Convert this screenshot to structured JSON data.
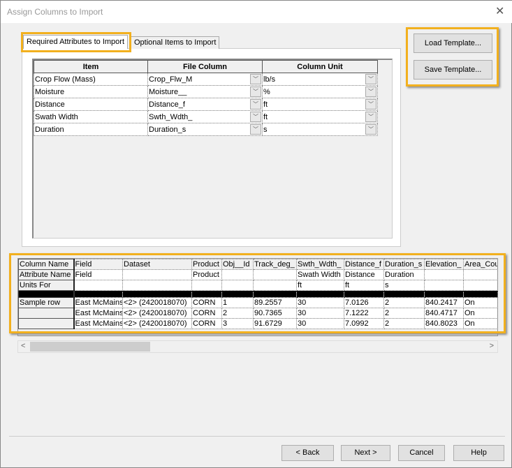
{
  "window": {
    "title": "Assign Columns to Import",
    "close": "✕"
  },
  "tabs": [
    {
      "label": "Required Attributes to Import"
    },
    {
      "label": "Optional Items to Import"
    }
  ],
  "required": {
    "headers": [
      "Item",
      "File Column",
      "Column Unit"
    ],
    "rows": [
      {
        "item": "Crop Flow (Mass)",
        "file_column": "Crop_Flw_M",
        "unit": "lb/s"
      },
      {
        "item": "Moisture",
        "file_column": "Moisture__",
        "unit": "%"
      },
      {
        "item": "Distance",
        "file_column": "Distance_f",
        "unit": "ft"
      },
      {
        "item": "Swath Width",
        "file_column": "Swth_Wdth_",
        "unit": "ft"
      },
      {
        "item": "Duration",
        "file_column": "Duration_s",
        "unit": "s"
      }
    ]
  },
  "template": {
    "load": "Load Template...",
    "save": "Save Template..."
  },
  "preview": {
    "row_headers": [
      "Column Name",
      "Attribute Name",
      "Units For",
      "",
      "Sample row",
      "",
      ""
    ],
    "columns": [
      "Field",
      "Dataset",
      "Product",
      "Obj__Id",
      "Track_deg_",
      "Swth_Wdth_",
      "Distance_f",
      "Duration_s",
      "Elevation_",
      "Area_Cou"
    ],
    "attribute_names": [
      "Field",
      "",
      "Product",
      "",
      "",
      "Swath Width",
      "Distance",
      "Duration",
      "",
      ""
    ],
    "units": [
      "",
      "",
      "",
      "",
      "",
      "ft",
      "ft",
      "s",
      "",
      ""
    ],
    "rows": [
      [
        "East McMains",
        "<2> (2420018070)",
        "CORN",
        "1",
        "89.2557",
        "30",
        "7.0126",
        "2",
        "840.2417",
        "On"
      ],
      [
        "East McMains",
        "<2> (2420018070)",
        "CORN",
        "2",
        "90.7365",
        "30",
        "7.1222",
        "2",
        "840.4717",
        "On"
      ],
      [
        "East McMains",
        "<2> (2420018070)",
        "CORN",
        "3",
        "91.6729",
        "30",
        "7.0992",
        "2",
        "840.8023",
        "On"
      ]
    ]
  },
  "scroll": {
    "left": "<",
    "right": ">"
  },
  "footer": {
    "back": "< Back",
    "next": "Next >",
    "cancel": "Cancel",
    "help": "Help"
  }
}
